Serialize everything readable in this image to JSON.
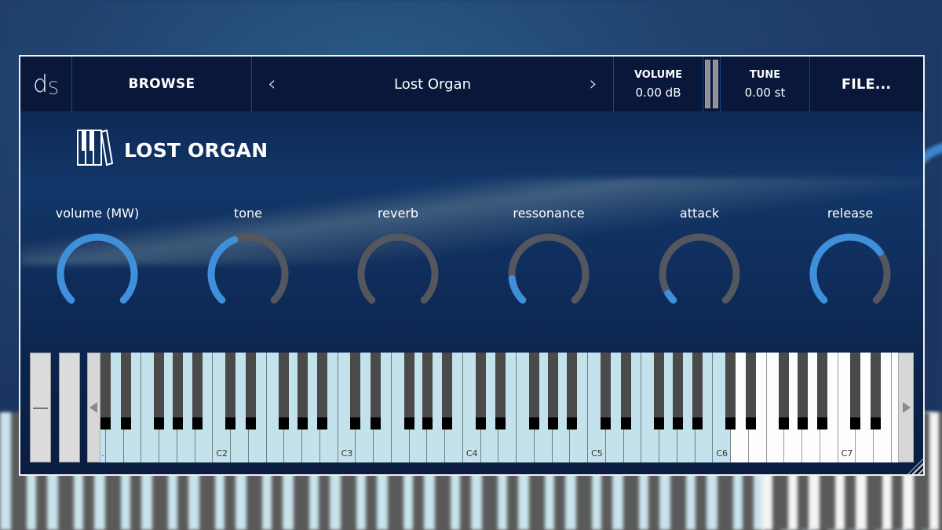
{
  "topbar": {
    "logo_main": "d",
    "logo_sub": "S",
    "browse_label": "BROWSE",
    "prev_icon": "‹",
    "next_icon": "›",
    "preset_name": "Lost Organ",
    "volume": {
      "label": "VOLUME",
      "value": "0.00 dB"
    },
    "tune": {
      "label": "TUNE",
      "value": "0.00 st"
    },
    "file_label": "FILE..."
  },
  "instrument": {
    "title": "LOST ORGAN",
    "icon": "library-books-icon"
  },
  "colors": {
    "accent": "#3f8fdb",
    "track": "#55575e",
    "keys_in_range": "#c4e2ec",
    "keys_out_range": "#fdfdfd"
  },
  "knobs": [
    {
      "id": "volume",
      "label": "volume (MW)",
      "value": 1.0
    },
    {
      "id": "tone",
      "label": "tone",
      "value": 0.42
    },
    {
      "id": "reverb",
      "label": "reverb",
      "value": 0.0
    },
    {
      "id": "ressonance",
      "label": "ressonance",
      "value": 0.14
    },
    {
      "id": "attack",
      "label": "attack",
      "value": 0.05
    },
    {
      "id": "release",
      "label": "release",
      "value": 0.7
    }
  ],
  "keyboard": {
    "first_octave": 1,
    "last_octave": 7,
    "range_highlight_end": "C6",
    "octave_labels": [
      "C2",
      "C3",
      "C4",
      "C5",
      "C6",
      "C7"
    ],
    "first_key_label": "."
  }
}
